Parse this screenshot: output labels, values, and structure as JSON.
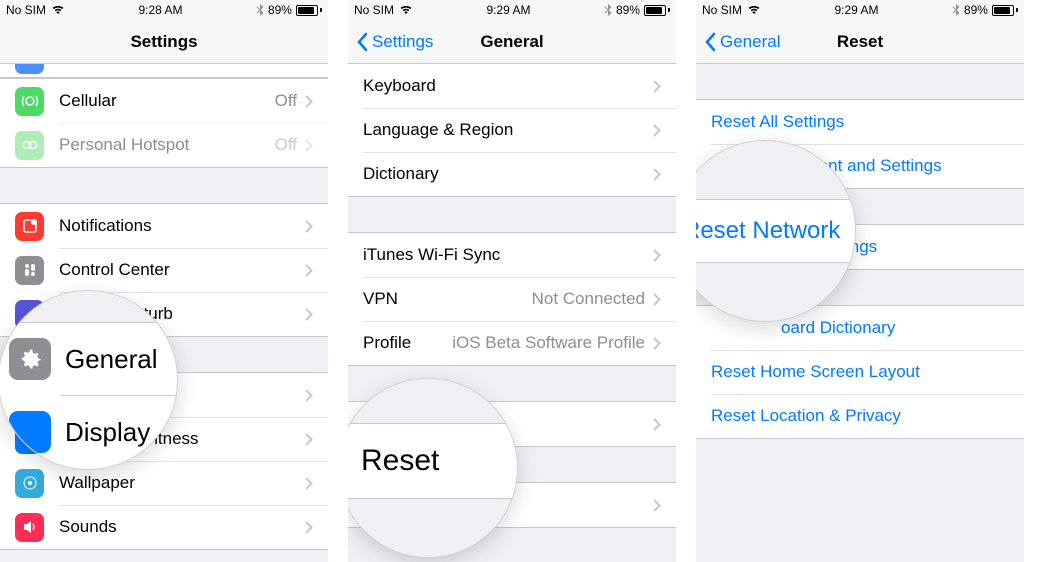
{
  "status": {
    "carrier": "No SIM",
    "time1": "9:28 AM",
    "time2": "9:29 AM",
    "time3": "9:29 AM",
    "battery_pct": "89%",
    "battery_fill": 89
  },
  "screen1": {
    "title": "Settings",
    "rows_a": [
      {
        "icon": "cellular-icon",
        "icon_class": "ic-cellular",
        "label": "Cellular",
        "value": "Off",
        "dimmed": false
      },
      {
        "icon": "hotspot-icon",
        "icon_class": "ic-green",
        "label": "Personal Hotspot",
        "value": "Off",
        "dimmed": true
      }
    ],
    "rows_b": [
      {
        "icon": "notifications-icon",
        "icon_class": "ic-red",
        "label": "Notifications"
      },
      {
        "icon": "control-center-icon",
        "icon_class": "ic-grey",
        "label": "Control Center"
      },
      {
        "icon": "dnd-icon",
        "icon_class": "ic-purple",
        "label": "Do Not Disturb",
        "partial_label": "Disturb"
      }
    ],
    "rows_c": [
      {
        "icon": "general-icon",
        "icon_class": "ic-gear",
        "label": "General"
      },
      {
        "icon": "display-icon",
        "icon_class": "ic-blue",
        "label": "Display & Brightness",
        "partial_label": "ghtness"
      },
      {
        "icon": "wallpaper-icon",
        "icon_class": "ic-cyan",
        "label": "Wallpaper"
      },
      {
        "icon": "sounds-icon",
        "icon_class": "ic-pink",
        "label": "Sounds"
      }
    ],
    "mag_general": "General",
    "mag_display": "Display"
  },
  "screen2": {
    "back": "Settings",
    "title": "General",
    "rows_a": [
      {
        "label": "Keyboard"
      },
      {
        "label": "Language & Region"
      },
      {
        "label": "Dictionary"
      }
    ],
    "rows_b": [
      {
        "label": "iTunes Wi-Fi Sync"
      },
      {
        "label": "VPN",
        "value": "Not Connected"
      },
      {
        "label": "Profile",
        "value": "iOS Beta Software Profile"
      }
    ],
    "rows_c": [
      {
        "label": ""
      }
    ],
    "rows_d": [
      {
        "label": ""
      }
    ],
    "mag_reset": "Reset"
  },
  "screen3": {
    "back": "General",
    "title": "Reset",
    "rows_a": [
      {
        "label": "Reset All Settings"
      },
      {
        "label": "Erase All Content and Settings"
      }
    ],
    "rows_b": [
      {
        "label": "Reset Network Settings",
        "display": "ings"
      }
    ],
    "rows_c": [
      {
        "label": "Reset Keyboard Dictionary",
        "display": "oard Dictionary"
      },
      {
        "label": "Reset Home Screen Layout"
      },
      {
        "label": "Reset Location & Privacy"
      }
    ],
    "mag_network": "Reset Network"
  }
}
